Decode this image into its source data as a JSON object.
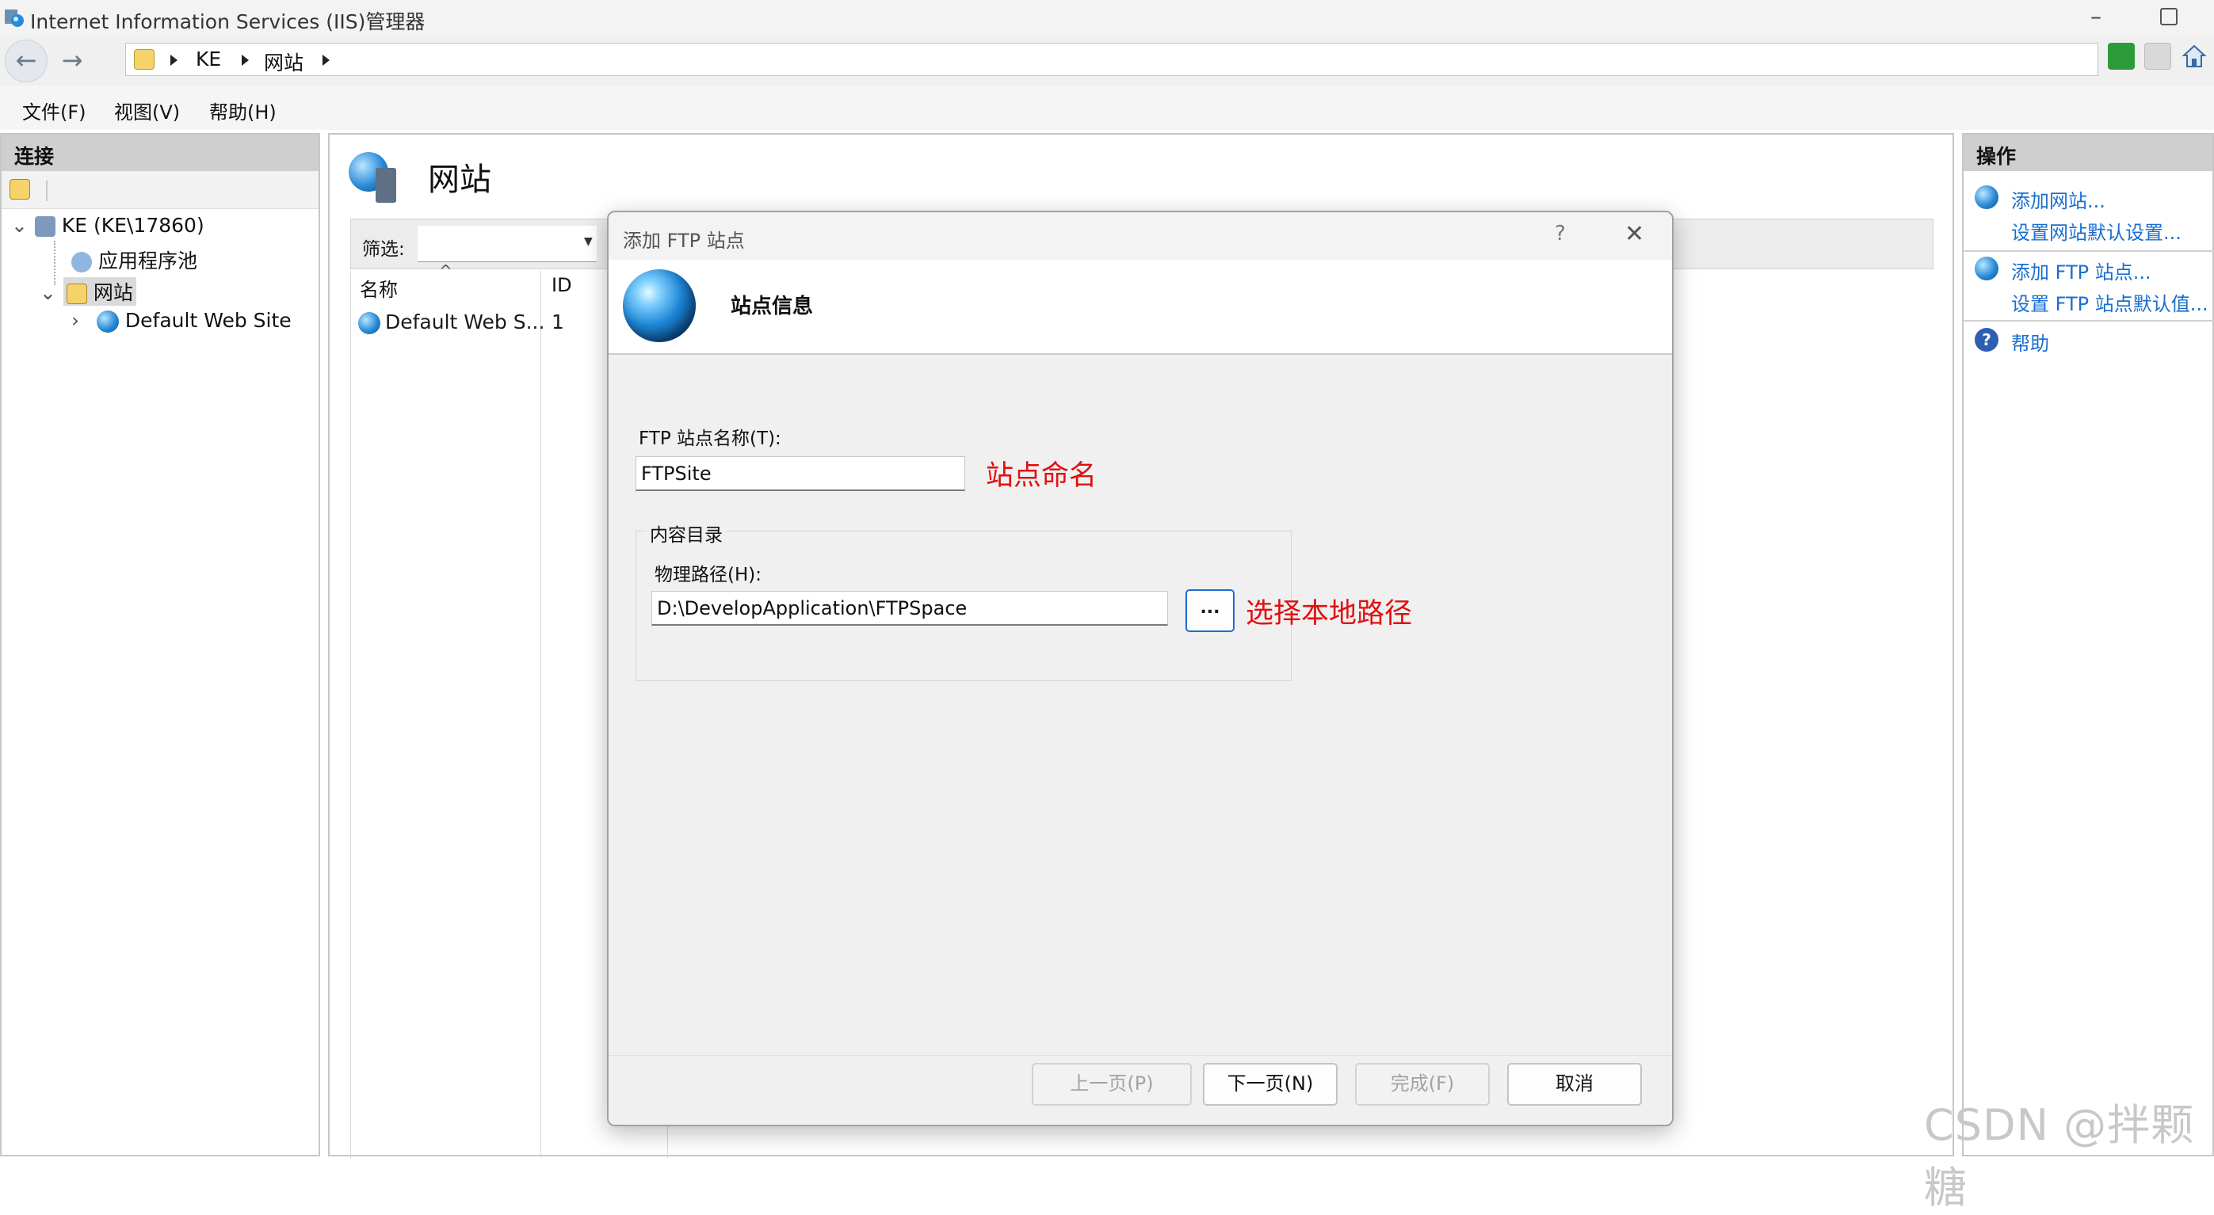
{
  "window": {
    "title": "Internet Information Services (IIS)管理器",
    "icon": "iis-app-icon"
  },
  "address_bar": {
    "crumbs": [
      "KE",
      "网站"
    ],
    "icons": [
      "back-arrow-icon",
      "forward-arrow-icon",
      "server-folder-icon",
      "refresh-connection-icon",
      "stop-icon",
      "home-icon"
    ]
  },
  "menu": {
    "file": "文件(F)",
    "view": "视图(V)",
    "help": "帮助(H)"
  },
  "connections": {
    "header": "连接",
    "tree": {
      "server": "KE (KE\\17860)",
      "app_pools": "应用程序池",
      "sites": "网站",
      "default_site": "Default Web Site"
    }
  },
  "center": {
    "title": "网站",
    "filter_label": "筛选:",
    "columns": {
      "name": "名称",
      "id": "ID"
    },
    "rows": [
      {
        "name": "Default Web S...",
        "id": "1"
      }
    ]
  },
  "actions": {
    "header": "操作",
    "add_website": "添加网站...",
    "set_website_defaults": "设置网站默认设置...",
    "add_ftp_site": "添加 FTP 站点...",
    "set_ftp_defaults": "设置 FTP 站点默认值...",
    "help": "帮助"
  },
  "dialog": {
    "title": "添加 FTP 站点",
    "help_glyph": "?",
    "close_glyph": "✕",
    "banner_title": "站点信息",
    "site_name_label": "FTP 站点名称(T):",
    "site_name_value": "FTPSite",
    "content_dir_group": "内容目录",
    "physical_path_label": "物理路径(H):",
    "physical_path_value": "D:\\DevelopApplication\\FTPSpace",
    "browse_button": "...",
    "buttons": {
      "prev": "上一页(P)",
      "next": "下一页(N)",
      "finish": "完成(F)",
      "cancel": "取消"
    }
  },
  "annotations": {
    "name_note": "站点命名",
    "path_note": "选择本地路径",
    "color": "#e01010"
  },
  "watermark": "CSDN @拌颗糖",
  "colors": {
    "link": "#1a6fd0",
    "panel_header": "#cfcfcf"
  }
}
